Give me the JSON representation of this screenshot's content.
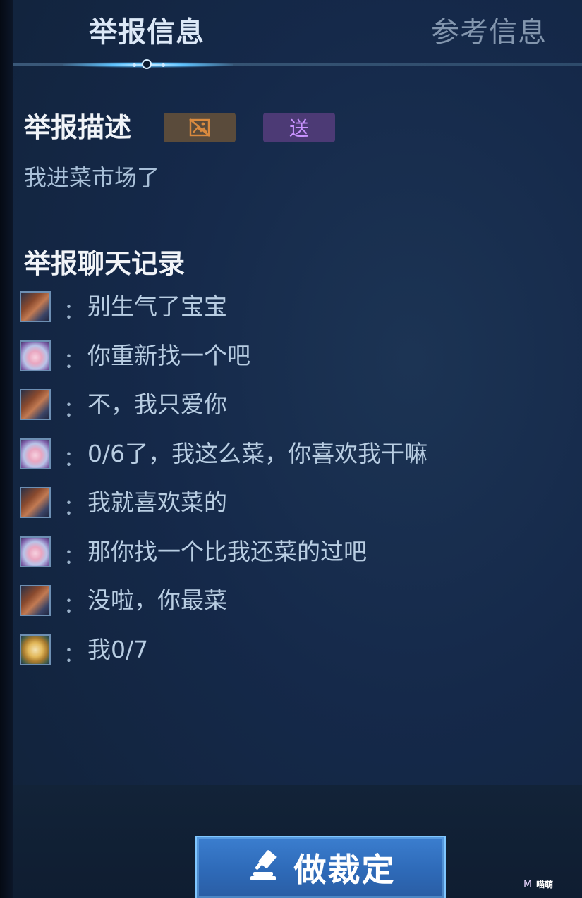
{
  "tabs": {
    "active": "举报信息",
    "inactive": "参考信息"
  },
  "description": {
    "heading": "举报描述",
    "badge_icon": "no-image-icon",
    "badge_text": "送",
    "text": "我进菜市场了"
  },
  "chat": {
    "heading": "举报聊天记录",
    "separator": "：",
    "messages": [
      {
        "avatar": "avatar-brown-hair-boy",
        "text": "别生气了宝宝"
      },
      {
        "avatar": "avatar-white-hair-girl",
        "text": "你重新找一个吧"
      },
      {
        "avatar": "avatar-brown-hair-boy",
        "text": "不，我只爱你"
      },
      {
        "avatar": "avatar-white-hair-girl",
        "text": "0/6了，我这么菜，你喜欢我干嘛"
      },
      {
        "avatar": "avatar-brown-hair-boy",
        "text": "我就喜欢菜的"
      },
      {
        "avatar": "avatar-white-hair-girl",
        "text": "那你找一个比我还菜的过吧"
      },
      {
        "avatar": "avatar-brown-hair-boy",
        "text": "没啦，你最菜"
      },
      {
        "avatar": "avatar-blonde-hero",
        "text": "我0/7"
      }
    ]
  },
  "action": {
    "label": "做裁定",
    "icon": "gavel-icon"
  },
  "watermark": {
    "logo": "M",
    "text": "喵萌"
  },
  "colors": {
    "panel": "#15294a",
    "accent_blue": "#3b7ecf",
    "text_light": "#f1f4f8",
    "text_msg": "#b8cde2"
  }
}
